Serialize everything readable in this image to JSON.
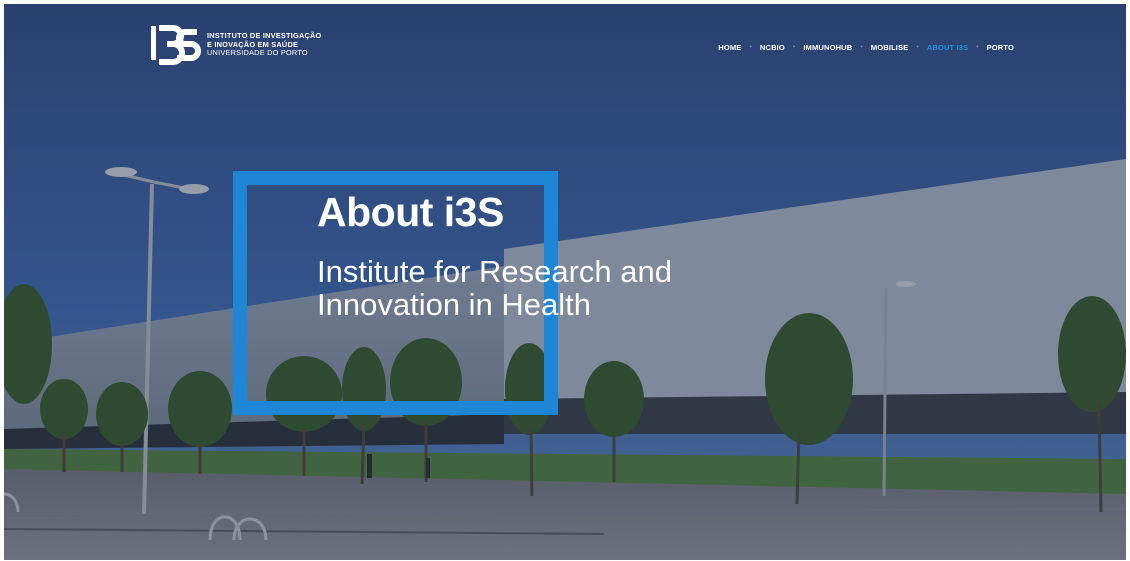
{
  "logo": {
    "line1": "INSTITUTO DE INVESTIGAÇÃO",
    "line2": "E INOVAÇÃO EM SAÚDE",
    "line3": "UNIVERSIDADE DO PORTO"
  },
  "nav": {
    "items": [
      {
        "label": "HOME"
      },
      {
        "label": "NCBIO"
      },
      {
        "label": "IMMUNOHUB"
      },
      {
        "label": "MOBILISE"
      },
      {
        "label": "ABOUT I3S"
      },
      {
        "label": "PORTO"
      }
    ],
    "active_index": 4
  },
  "hero": {
    "title": "About i3S",
    "subtitle_line1": "Institute for Research and",
    "subtitle_line2": "Innovation in Health"
  },
  "colors": {
    "accent": "#1e86d6",
    "sky": "#2d4f85",
    "text": "#ffffff"
  }
}
